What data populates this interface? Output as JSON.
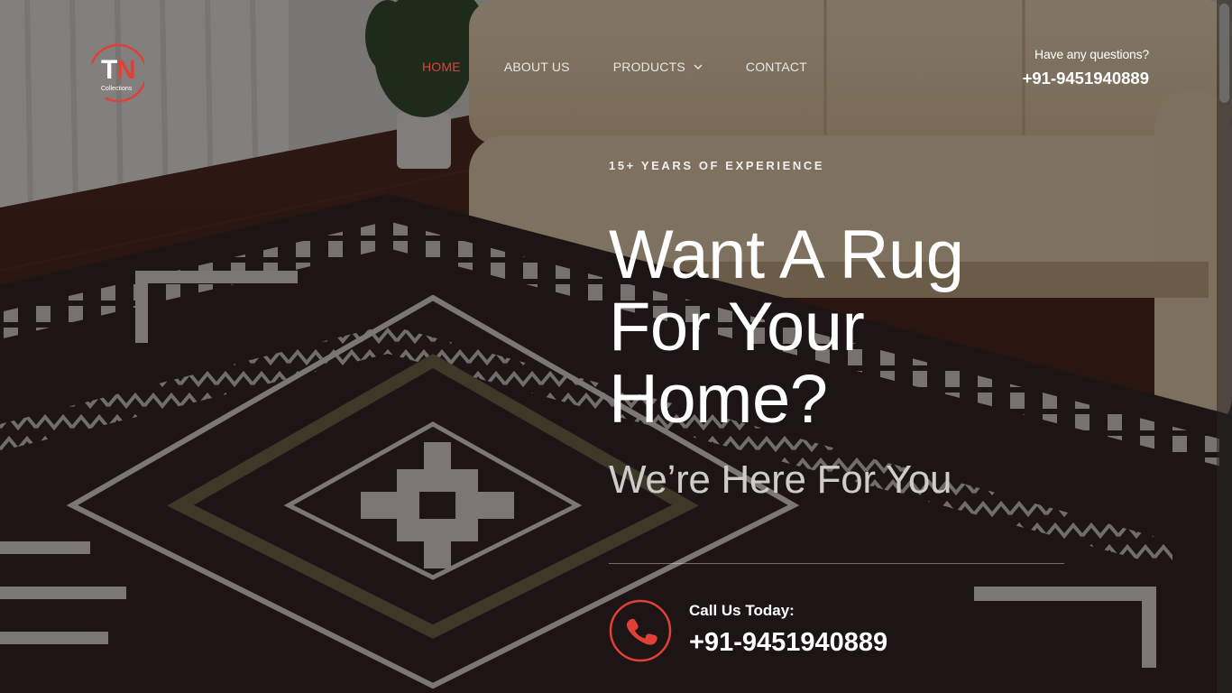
{
  "brand": {
    "logo_text": "TN",
    "logo_subtext": "Collections",
    "accent": "#e14036"
  },
  "nav": {
    "items": [
      {
        "label": "HOME",
        "active": true
      },
      {
        "label": "ABOUT US",
        "active": false
      },
      {
        "label": "PRODUCTS",
        "active": false,
        "dropdown": true
      },
      {
        "label": "CONTACT",
        "active": false
      }
    ]
  },
  "header_contact": {
    "question": "Have any questions?",
    "phone": "+91-9451940889"
  },
  "hero": {
    "eyebrow": "15+ YEARS OF EXPERIENCE",
    "headline_lines": [
      "Want A Rug",
      "For Your",
      "Home?"
    ],
    "subheadline": "We’re Here For You"
  },
  "call": {
    "label": "Call Us Today:",
    "number": "+91-9451940889",
    "icon": "phone-icon"
  }
}
